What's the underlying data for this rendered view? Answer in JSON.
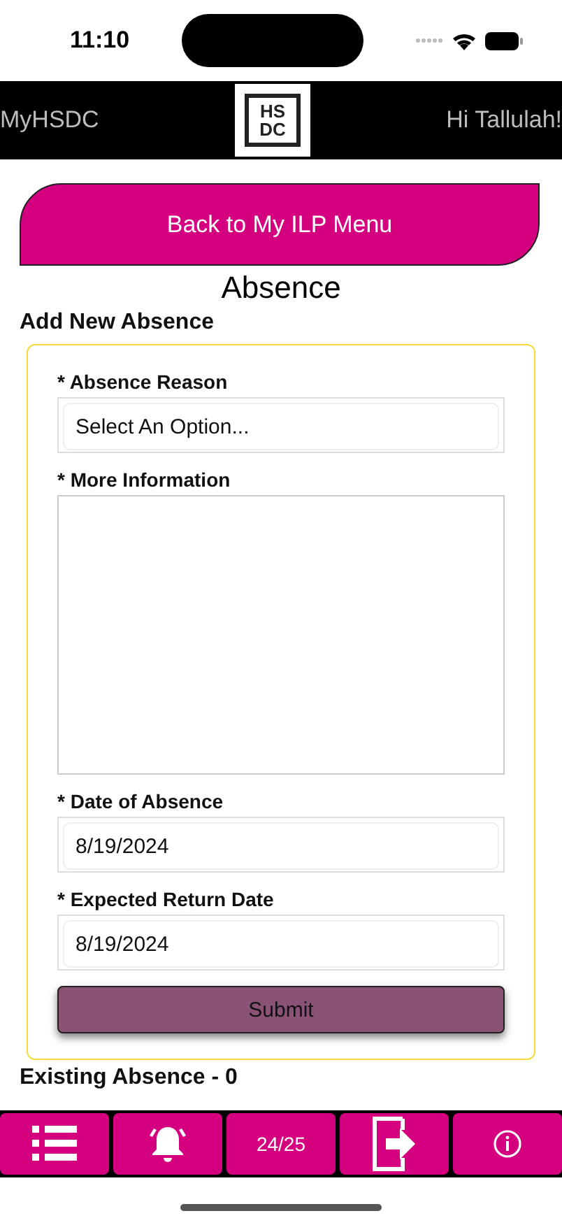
{
  "status_bar": {
    "time": "11:10"
  },
  "header": {
    "app_name": "MyHSDC",
    "logo": [
      "HS",
      "DC"
    ],
    "greeting": "Hi Tallulah!"
  },
  "back_button": "Back to My ILP Menu",
  "page_title": "Absence",
  "section_title": "Add New Absence",
  "form": {
    "fields": [
      {
        "kind": "select",
        "label": "* Absence Reason",
        "value": "Select An Option..."
      },
      {
        "kind": "textarea",
        "label": "* More Information"
      },
      {
        "kind": "text",
        "label": "* Date of Absence",
        "value": "8/19/2024"
      },
      {
        "kind": "text",
        "label": "* Expected Return Date",
        "value": "8/19/2024"
      }
    ],
    "submit": "Submit"
  },
  "existing_title": "Existing Absence - 0",
  "tab_bar": [
    {
      "kind": "menu"
    },
    {
      "kind": "bell"
    },
    {
      "kind": "text",
      "label": "24/25"
    },
    {
      "kind": "logout"
    },
    {
      "kind": "info"
    }
  ]
}
